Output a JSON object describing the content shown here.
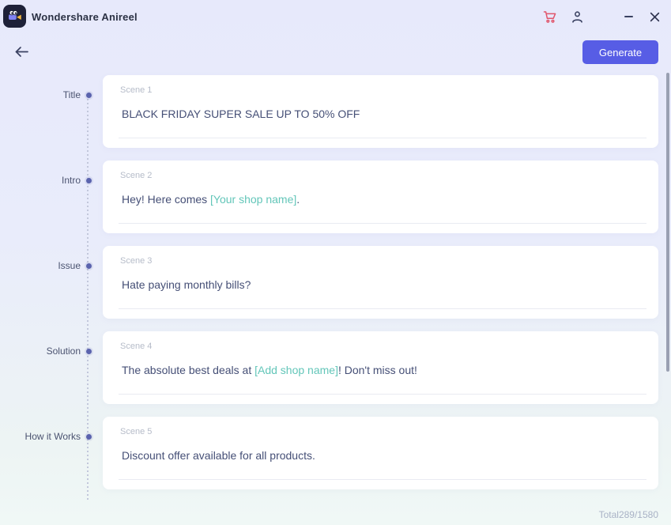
{
  "colors": {
    "accent": "#575de5",
    "placeholder_highlight": "#63c6b9",
    "cart_icon_red": "#e0556b",
    "card_background": "#ffffff"
  },
  "titlebar": {
    "app_title": "Wondershare Anireel",
    "minimize_glyph": "–",
    "close_glyph": "✕"
  },
  "header": {
    "back_glyph": "←",
    "generate_label": "Generate"
  },
  "timeline": {
    "items": [
      {
        "label": "Title"
      },
      {
        "label": "Intro"
      },
      {
        "label": "Issue"
      },
      {
        "label": "Solution"
      },
      {
        "label": "How it Works"
      }
    ]
  },
  "scenes": [
    {
      "label": "Scene 1",
      "segments": [
        {
          "text": "BLACK FRIDAY SUPER SALE UP TO 50% OFF",
          "highlight": false
        }
      ]
    },
    {
      "label": "Scene 2",
      "segments": [
        {
          "text": "Hey! Here comes ",
          "highlight": false
        },
        {
          "text": "[Your shop name]",
          "highlight": true
        },
        {
          "text": ".",
          "highlight": false
        }
      ]
    },
    {
      "label": "Scene 3",
      "segments": [
        {
          "text": "Hate paying monthly bills?",
          "highlight": false
        }
      ]
    },
    {
      "label": "Scene 4",
      "segments": [
        {
          "text": "The absolute best deals at ",
          "highlight": false
        },
        {
          "text": "[Add shop name]",
          "highlight": true
        },
        {
          "text": "! Don't miss out!",
          "highlight": false
        }
      ]
    },
    {
      "label": "Scene 5",
      "segments": [
        {
          "text": "Discount offer available for all products.",
          "highlight": false
        }
      ]
    }
  ],
  "footer": {
    "total_label": "Total",
    "character_count": "289/1580"
  }
}
